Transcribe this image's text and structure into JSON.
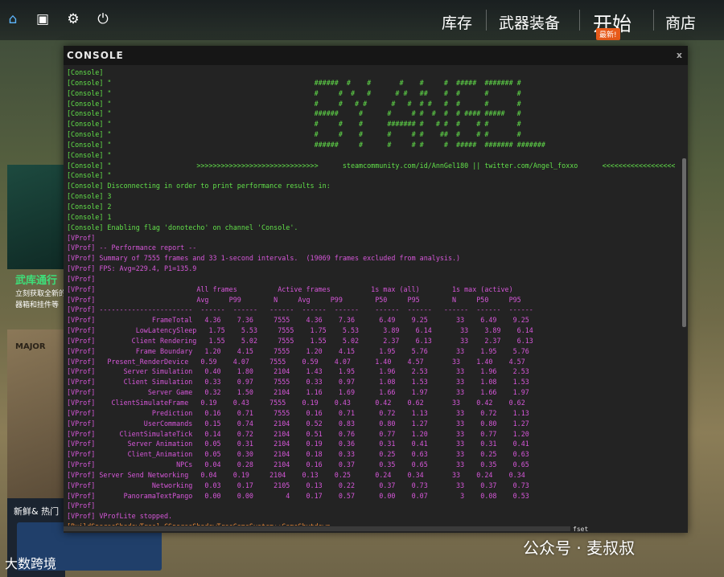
{
  "topbar": {
    "icons": [
      "home-icon",
      "tv-icon",
      "gear-icon",
      "power-icon"
    ],
    "nav": [
      "库存",
      "武器装备",
      "开始",
      "商店"
    ],
    "start_badge": "最新!"
  },
  "sidebar": {
    "card1_title": "武库通行",
    "card1_line1": "立刻获取全新的",
    "card1_line2": "器箱和挂件等",
    "card2_text": "MAJOR",
    "card3_title": "新鲜& 热门"
  },
  "console": {
    "title": "CONSOLE",
    "close": "x",
    "lines": [
      {
        "c": "g",
        "t": "[Console]"
      },
      {
        "c": "g",
        "t": "[Console] \"                                                  ######  #    #       #    #     #  #####  ####### #"
      },
      {
        "c": "g",
        "t": "[Console] \"                                                  #     #  #   #      # #   ##    #  #      #       #"
      },
      {
        "c": "g",
        "t": "[Console] \"                                                  #     #   # #      #   #  # #   #  #      #       #"
      },
      {
        "c": "g",
        "t": "[Console] \"                                                  ######     #      #     # #  #  #  # #### #####   #"
      },
      {
        "c": "g",
        "t": "[Console] \"                                                  #     #    #      ####### #   # #  #    # #       #"
      },
      {
        "c": "g",
        "t": "[Console] \"                                                  #     #    #      #     # #    ##  #    # #       #"
      },
      {
        "c": "g",
        "t": "[Console] \"                                                  ######     #      #     # #     #  #####  ####### #######"
      },
      {
        "c": "g",
        "t": "[Console] \""
      },
      {
        "c": "g",
        "t": "[Console] \"                     >>>>>>>>>>>>>>>>>>>>>>>>>>>>>>      steamcommunity.com/id/AnnGel180 || twitter.com/Angel_foxxo      <<<<<<<<<<<<<<<<<<<<<<<<<<<<<<"
      },
      {
        "c": "g",
        "t": "[Console] \""
      },
      {
        "c": "g",
        "t": "[Console] Disconnecting in order to print performance results in:"
      },
      {
        "c": "g",
        "t": "[Console] 3"
      },
      {
        "c": "g",
        "t": "[Console] 2"
      },
      {
        "c": "g",
        "t": "[Console] 1"
      },
      {
        "c": "g",
        "t": "[Console] Enabling flag 'donotecho' on channel 'Console'."
      },
      {
        "c": "m",
        "t": "[VProf]"
      },
      {
        "c": "m",
        "t": "[VProf] -- Performance report --"
      },
      {
        "c": "m",
        "t": "[VProf] Summary of 7555 frames and 33 1-second intervals.  (19069 frames excluded from analysis.)"
      },
      {
        "c": "m",
        "t": "[VProf] FPS: Avg=229.4, P1=135.9"
      },
      {
        "c": "m",
        "t": "[VProf]"
      },
      {
        "c": "m",
        "t": "[VProf]                         All frames          Active frames          1s max (all)        1s max (active)"
      },
      {
        "c": "m",
        "t": "[VProf]                         Avg     P99        N     Avg     P99        P50     P95        N     P50     P95"
      },
      {
        "c": "m",
        "t": "[VProf] -----------------------  ------  ------   ------  ------  ------    ------  ------   ------  ------  ------"
      },
      {
        "c": "m",
        "t": "[VProf]              FrameTotal   4.36    7.36     7555    4.36    7.36      6.49    9.25       33    6.49    9.25"
      },
      {
        "c": "m",
        "t": "[VProf]          LowLatencySleep   1.75    5.53     7555    1.75    5.53      3.89    6.14       33    3.89    6.14"
      },
      {
        "c": "m",
        "t": "[VProf]         Client Rendering   1.55    5.02     7555    1.55    5.02      2.37    6.13       33    2.37    6.13"
      },
      {
        "c": "m",
        "t": "[VProf]          Frame Boundary   1.20    4.15     7555    1.20    4.15      1.95    5.76       33    1.95    5.76"
      },
      {
        "c": "m",
        "t": "[VProf]   Present_RenderDevice   0.59    4.07     7555    0.59    4.07      1.40    4.57       33    1.40    4.57"
      },
      {
        "c": "m",
        "t": "[VProf]       Server Simulation   0.40    1.80     2104    1.43    1.95      1.96    2.53       33    1.96    2.53"
      },
      {
        "c": "m",
        "t": "[VProf]       Client Simulation   0.33    0.97     7555    0.33    0.97      1.08    1.53       33    1.08    1.53"
      },
      {
        "c": "m",
        "t": "[VProf]             Server Game   0.32    1.50     2104    1.16    1.69      1.66    1.97       33    1.66    1.97"
      },
      {
        "c": "m",
        "t": "[VProf]    ClientSimulateFrame   0.19    0.43     7555    0.19    0.43      0.42    0.62       33    0.42    0.62"
      },
      {
        "c": "m",
        "t": "[VProf]              Prediction   0.16    0.71     7555    0.16    0.71      0.72    1.13       33    0.72    1.13"
      },
      {
        "c": "m",
        "t": "[VProf]            UserCommands   0.15    0.74     2104    0.52    0.83      0.80    1.27       33    0.80    1.27"
      },
      {
        "c": "m",
        "t": "[VProf]      ClientSimulateTick   0.14    0.72     2104    0.51    0.76      0.77    1.20       33    0.77    1.20"
      },
      {
        "c": "m",
        "t": "[VProf]        Server Animation   0.05    0.31     2104    0.19    0.36      0.31    0.41       33    0.31    0.41"
      },
      {
        "c": "m",
        "t": "[VProf]        Client_Animation   0.05    0.30     2104    0.18    0.33      0.25    0.63       33    0.25    0.63"
      },
      {
        "c": "m",
        "t": "[VProf]                    NPCs   0.04    0.28     2104    0.16    0.37      0.35    0.65       33    0.35    0.65"
      },
      {
        "c": "m",
        "t": "[VProf] Server Send Networking   0.04    0.19     2104    0.13    0.25      0.24    0.34       33    0.24    0.34"
      },
      {
        "c": "m",
        "t": "[VProf]              Networking   0.03    0.17     2105    0.13    0.22      0.37    0.73       33    0.37    0.73"
      },
      {
        "c": "m",
        "t": "[VProf]       PanoramaTextPango   0.00    0.00        4    0.17    0.57      0.00    0.07        3    0.08    0.53"
      },
      {
        "c": "m",
        "t": "[VProf]"
      },
      {
        "c": "m",
        "t": "[VProf] VProfLite stopped."
      },
      {
        "c": "o",
        "t": "[BuildSparseShadowTree] CSparseShadowTreeGameSystem::GameShutdown"
      }
    ],
    "footer_fragment": "fset"
  },
  "watermark": {
    "right": "公众号 · 麦叔叔",
    "left": "大数跨境"
  }
}
